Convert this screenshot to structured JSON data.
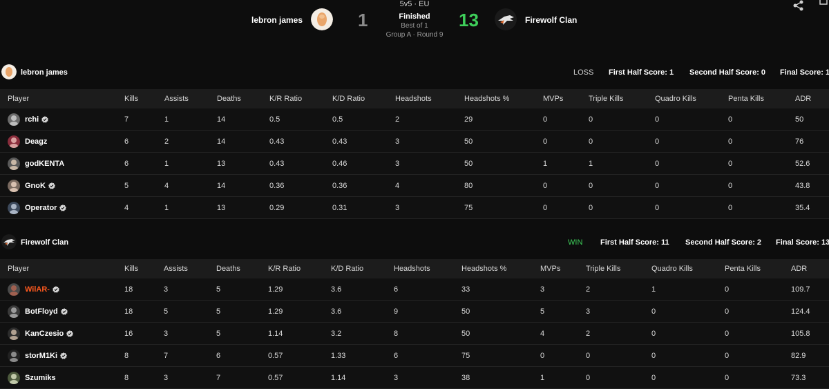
{
  "header": {
    "mode": "5v5 · EU",
    "status": "Finished",
    "best_of": "Best of 1",
    "group_round": "Group A · Round 9",
    "team_left": {
      "name": "lebron james",
      "score": "1"
    },
    "team_right": {
      "name": "Firewolf Clan",
      "score": "13"
    },
    "icons": {
      "share": "share-icon",
      "corner": "corner-icon"
    },
    "colors": {
      "loss_score": "#8a8a8a",
      "win_score": "#3ecf5a"
    }
  },
  "columns": [
    "Player",
    "Kills",
    "Assists",
    "Deaths",
    "K/R Ratio",
    "K/D Ratio",
    "Headshots",
    "Headshots %",
    "MVPs",
    "Triple Kills",
    "Quadro Kills",
    "Penta Kills",
    "ADR"
  ],
  "teams": [
    {
      "name": "lebron james",
      "result": "LOSS",
      "result_color": "#d0d0d0",
      "first_half": "First Half Score: 1",
      "second_half": "Second Half Score: 0",
      "final": "Final Score: 1",
      "players": [
        {
          "name": "rchi",
          "verified": true,
          "highlight": false,
          "stats": [
            "7",
            "1",
            "14",
            "0.5",
            "0.5",
            "2",
            "29",
            "0",
            "0",
            "0",
            "0",
            "50"
          ]
        },
        {
          "name": "Deagz",
          "verified": false,
          "highlight": false,
          "stats": [
            "6",
            "2",
            "14",
            "0.43",
            "0.43",
            "3",
            "50",
            "0",
            "0",
            "0",
            "0",
            "76"
          ]
        },
        {
          "name": "godKENTA",
          "verified": false,
          "highlight": false,
          "stats": [
            "6",
            "1",
            "13",
            "0.43",
            "0.46",
            "3",
            "50",
            "1",
            "1",
            "0",
            "0",
            "52.6"
          ]
        },
        {
          "name": "GnoK",
          "verified": true,
          "highlight": false,
          "stats": [
            "5",
            "4",
            "14",
            "0.36",
            "0.36",
            "4",
            "80",
            "0",
            "0",
            "0",
            "0",
            "43.8"
          ]
        },
        {
          "name": "Operator",
          "verified": true,
          "highlight": false,
          "stats": [
            "4",
            "1",
            "13",
            "0.29",
            "0.31",
            "3",
            "75",
            "0",
            "0",
            "0",
            "0",
            "35.4"
          ]
        }
      ]
    },
    {
      "name": "Firewolf Clan",
      "result": "WIN",
      "result_color": "#3ecf5a",
      "first_half": "First Half Score: 11",
      "second_half": "Second Half Score: 2",
      "final": "Final Score: 13",
      "players": [
        {
          "name": "WilAR-",
          "verified": true,
          "highlight": true,
          "stats": [
            "18",
            "3",
            "5",
            "1.29",
            "3.6",
            "6",
            "33",
            "3",
            "2",
            "1",
            "0",
            "109.7"
          ]
        },
        {
          "name": "BotFloyd",
          "verified": true,
          "highlight": false,
          "stats": [
            "18",
            "5",
            "5",
            "1.29",
            "3.6",
            "9",
            "50",
            "5",
            "3",
            "0",
            "0",
            "124.4"
          ]
        },
        {
          "name": "KanCzesio",
          "verified": true,
          "highlight": false,
          "stats": [
            "16",
            "3",
            "5",
            "1.14",
            "3.2",
            "8",
            "50",
            "4",
            "2",
            "0",
            "0",
            "105.8"
          ]
        },
        {
          "name": "storM1Ki",
          "verified": true,
          "highlight": false,
          "stats": [
            "8",
            "7",
            "6",
            "0.57",
            "1.33",
            "6",
            "75",
            "0",
            "0",
            "0",
            "0",
            "82.9"
          ]
        },
        {
          "name": "Szumiks",
          "verified": false,
          "highlight": false,
          "stats": [
            "8",
            "3",
            "7",
            "0.57",
            "1.14",
            "3",
            "38",
            "1",
            "0",
            "0",
            "0",
            "73.3"
          ]
        }
      ]
    }
  ]
}
